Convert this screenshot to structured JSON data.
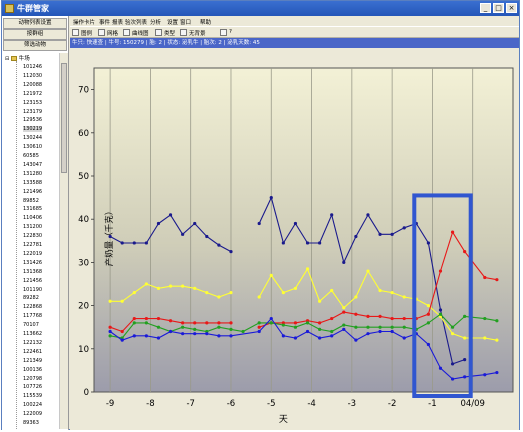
{
  "window": {
    "title": "牛群管家"
  },
  "left_panel": {
    "buttons": [
      "动物列表设置",
      "按群组",
      "筛选动物"
    ],
    "tree": {
      "root_label": "牛场",
      "items": [
        "101246",
        "112030",
        "120088",
        "121972",
        "123153",
        "123179",
        "129536",
        "130219",
        "130244",
        "130610",
        "60585",
        "143047",
        "131280",
        "133588",
        "121496",
        "89852",
        "131685",
        "110406",
        "131200",
        "122830",
        "122781",
        "122019",
        "131426",
        "131368",
        "121456",
        "101190",
        "89282",
        "122868",
        "117768",
        "70107",
        "113662",
        "122132",
        "122461",
        "121349",
        "100136",
        "120798",
        "107726",
        "115539",
        "100224",
        "122009",
        "89363",
        "122406"
      ],
      "selected_index": 7
    }
  },
  "menubar": [
    "操作卡片",
    "事件",
    "报表",
    "验次列表",
    "分析",
    "设置",
    "窗口",
    "帮助"
  ],
  "toolbar": {
    "items": [
      "图例",
      "网格",
      "曲线图",
      "类型",
      "无背景",
      "?"
    ],
    "icon_names": [
      "legend-icon",
      "grid-icon",
      "curve-chart-icon",
      "type-icon",
      "background-icon",
      "help-icon"
    ]
  },
  "infobar": "  牛只: 快速查 | 牛号: 150279 | 胎: 2 | 状态: 泌乳牛 | 胎次: 2 | 泌乳天数: 45",
  "chart_data": {
    "type": "line",
    "title": "",
    "xlabel": "天",
    "ylabel": "产奶量（千克）",
    "ylim": [
      0,
      75
    ],
    "xlim": [
      -9.4,
      1.0
    ],
    "ytick_labels": [
      "0",
      "10",
      "20",
      "30",
      "40",
      "50",
      "60",
      "70"
    ],
    "yticks": [
      0,
      10,
      20,
      30,
      40,
      50,
      60,
      70
    ],
    "xtick_labels": [
      "-9",
      "-8",
      "-7",
      "-6",
      "-5",
      "-4",
      "-3",
      "-2",
      "-1",
      "04/09"
    ],
    "xticks": [
      -9,
      -8,
      -7,
      -6,
      -5,
      -4,
      -3,
      -2,
      -1,
      0
    ],
    "grid": true,
    "highlight_box": {
      "x": [
        -1.45,
        -0.05
      ],
      "y": [
        0,
        45.5
      ],
      "color": "#3056d0"
    },
    "series": [
      {
        "color": "#1a1a8c",
        "segments": [
          [
            [
              -9,
              36
            ],
            [
              -8.7,
              34.5
            ],
            [
              -8.4,
              34.5
            ],
            [
              -8.1,
              34.5
            ],
            [
              -7.8,
              39
            ],
            [
              -7.5,
              41
            ],
            [
              -7.2,
              36.5
            ],
            [
              -6.9,
              39
            ],
            [
              -6.6,
              36
            ],
            [
              -6.3,
              34
            ],
            [
              -6,
              32.5
            ]
          ],
          [
            [
              -5.3,
              39
            ],
            [
              -5,
              45
            ],
            [
              -4.7,
              34.5
            ],
            [
              -4.4,
              39
            ],
            [
              -4.1,
              34.5
            ],
            [
              -3.8,
              34.5
            ],
            [
              -3.5,
              41
            ],
            [
              -3.2,
              30
            ],
            [
              -2.9,
              36
            ],
            [
              -2.6,
              41
            ],
            [
              -2.3,
              36.5
            ],
            [
              -2,
              36.5
            ],
            [
              -1.7,
              38
            ],
            [
              -1.4,
              39
            ],
            [
              -1.1,
              34.5
            ],
            [
              -0.8,
              19
            ],
            [
              -0.5,
              6.5
            ],
            [
              -0.2,
              7.5
            ]
          ]
        ]
      },
      {
        "color": "#ffff33",
        "segments": [
          [
            [
              -9,
              21
            ],
            [
              -8.7,
              21
            ],
            [
              -8.4,
              23
            ],
            [
              -8.1,
              25
            ],
            [
              -7.8,
              24
            ],
            [
              -7.5,
              24.5
            ],
            [
              -7.2,
              24.5
            ],
            [
              -6.9,
              24
            ],
            [
              -6.6,
              23
            ],
            [
              -6.3,
              22
            ],
            [
              -6,
              23
            ]
          ],
          [
            [
              -5.3,
              22
            ],
            [
              -5,
              27
            ],
            [
              -4.7,
              23
            ],
            [
              -4.4,
              24
            ],
            [
              -4.1,
              28.5
            ],
            [
              -3.8,
              21
            ],
            [
              -3.5,
              23.5
            ],
            [
              -3.2,
              19.5
            ],
            [
              -2.9,
              22
            ],
            [
              -2.6,
              28
            ],
            [
              -2.3,
              23.5
            ],
            [
              -2,
              23
            ],
            [
              -1.7,
              22
            ],
            [
              -1.4,
              21.5
            ],
            [
              -1.1,
              20
            ],
            [
              -0.8,
              17.5
            ],
            [
              -0.5,
              13.5
            ],
            [
              -0.2,
              12.5
            ],
            [
              0.3,
              12.5
            ],
            [
              0.6,
              12
            ]
          ]
        ]
      },
      {
        "color": "#e81818",
        "segments": [
          [
            [
              -9,
              15
            ],
            [
              -8.7,
              14
            ],
            [
              -8.4,
              17
            ],
            [
              -8.1,
              17
            ],
            [
              -7.8,
              17
            ],
            [
              -7.5,
              16.5
            ],
            [
              -7.2,
              16
            ],
            [
              -6.9,
              16
            ],
            [
              -6.6,
              16
            ],
            [
              -6.3,
              16
            ],
            [
              -6,
              16
            ]
          ],
          [
            [
              -5.3,
              15
            ],
            [
              -5,
              16
            ],
            [
              -4.7,
              16
            ],
            [
              -4.4,
              16
            ],
            [
              -4.1,
              16.5
            ],
            [
              -3.8,
              16
            ],
            [
              -3.5,
              17
            ],
            [
              -3.2,
              18.5
            ],
            [
              -2.9,
              18
            ],
            [
              -2.6,
              17.5
            ],
            [
              -2.3,
              17.5
            ],
            [
              -2,
              17
            ],
            [
              -1.7,
              17
            ],
            [
              -1.4,
              17
            ],
            [
              -1.1,
              18
            ],
            [
              -0.8,
              28
            ],
            [
              -0.5,
              37
            ],
            [
              -0.2,
              32.5
            ],
            [
              0.3,
              26.5
            ],
            [
              0.6,
              26
            ]
          ]
        ]
      },
      {
        "color": "#22a020",
        "segments": [
          [
            [
              -9,
              13
            ],
            [
              -8.7,
              12.5
            ],
            [
              -8.4,
              16
            ],
            [
              -8.1,
              16
            ],
            [
              -7.8,
              15
            ],
            [
              -7.5,
              14
            ],
            [
              -7.2,
              15
            ],
            [
              -6.9,
              14.5
            ],
            [
              -6.6,
              14
            ],
            [
              -6.3,
              15
            ],
            [
              -6,
              14.5
            ],
            [
              -5.7,
              14
            ],
            [
              -5.3,
              16
            ],
            [
              -5,
              16
            ],
            [
              -4.7,
              15.5
            ],
            [
              -4.4,
              15
            ],
            [
              -4.1,
              16
            ],
            [
              -3.8,
              14.5
            ],
            [
              -3.5,
              14
            ],
            [
              -3.2,
              15.5
            ],
            [
              -2.9,
              15
            ],
            [
              -2.6,
              15
            ],
            [
              -2.3,
              15
            ],
            [
              -2,
              15
            ],
            [
              -1.7,
              15
            ],
            [
              -1.4,
              14.5
            ],
            [
              -1.1,
              16
            ],
            [
              -0.8,
              18
            ],
            [
              -0.5,
              15
            ],
            [
              -0.2,
              17.5
            ],
            [
              0.3,
              17
            ],
            [
              0.6,
              16.5
            ]
          ]
        ]
      },
      {
        "color": "#1a1ad8",
        "segments": [
          [
            [
              -9,
              14
            ],
            [
              -8.7,
              12
            ],
            [
              -8.4,
              13
            ],
            [
              -8.1,
              13
            ],
            [
              -7.8,
              12.5
            ],
            [
              -7.5,
              14
            ],
            [
              -7.2,
              13.5
            ],
            [
              -6.9,
              13.5
            ],
            [
              -6.6,
              13.5
            ],
            [
              -6.3,
              13
            ],
            [
              -6,
              13
            ],
            [
              -5.3,
              14
            ],
            [
              -5,
              17
            ],
            [
              -4.7,
              13
            ],
            [
              -4.4,
              12.5
            ],
            [
              -4.1,
              14
            ],
            [
              -3.8,
              12.5
            ],
            [
              -3.5,
              13
            ],
            [
              -3.2,
              14.5
            ],
            [
              -2.9,
              12
            ],
            [
              -2.6,
              13.5
            ],
            [
              -2.3,
              14
            ],
            [
              -2,
              14
            ],
            [
              -1.7,
              12.5
            ],
            [
              -1.4,
              13.5
            ],
            [
              -1.1,
              11
            ],
            [
              -0.8,
              5.5
            ],
            [
              -0.5,
              3
            ],
            [
              -0.2,
              3.5
            ],
            [
              0.3,
              4
            ],
            [
              0.6,
              4.5
            ]
          ]
        ]
      }
    ]
  }
}
